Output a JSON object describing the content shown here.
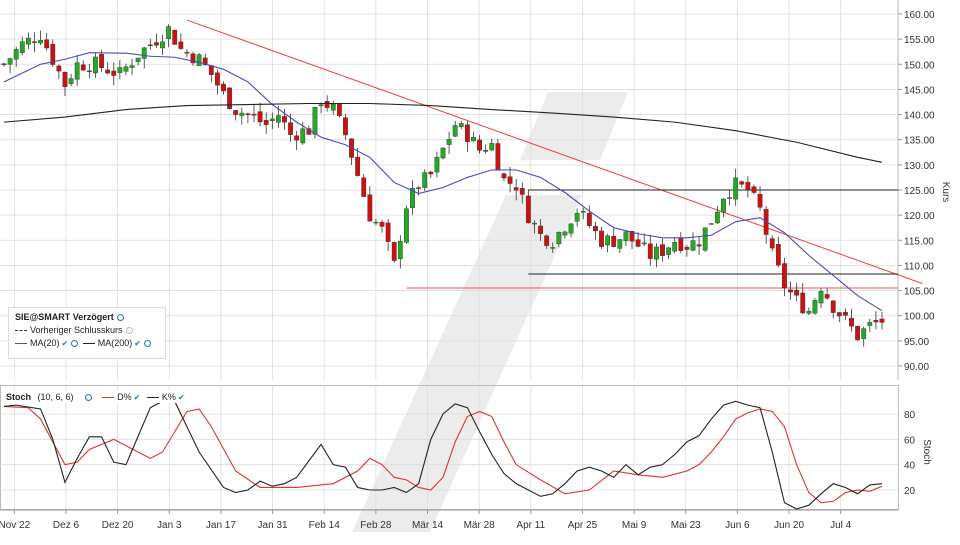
{
  "chart_data": [
    {
      "type": "candlestick",
      "title": "SIE@SMART Verzögert",
      "ylabel": "Kurs",
      "ylim": [
        86,
        162
      ],
      "y_ticks": [
        "160.00",
        "155.00",
        "150.00",
        "145.00",
        "140.00",
        "135.00",
        "130.00",
        "125.00",
        "120.00",
        "115.00",
        "110.00",
        "105.00",
        "100.00",
        "95.00",
        "90.00"
      ],
      "x_ticks": [
        "Nov 22",
        "Dez 6",
        "Dez 20",
        "Jan 3",
        "Jan 17",
        "Jan 31",
        "Feb 14",
        "Feb 28",
        "Mär 14",
        "Mär 28",
        "Apr 11",
        "Apr 25",
        "Mai 9",
        "Mai 23",
        "Jun 6",
        "Jun 20",
        "Jul 4"
      ],
      "grid": true,
      "legend": [
        "Vorheriger Schlusskurs",
        "MA(20)",
        "MA(200)"
      ],
      "close_anchors": [
        [
          0,
          150
        ],
        [
          3,
          154
        ],
        [
          6,
          156
        ],
        [
          8,
          151
        ],
        [
          10,
          146
        ],
        [
          12,
          150
        ],
        [
          15,
          150
        ],
        [
          17,
          149
        ],
        [
          19,
          148
        ],
        [
          22,
          152
        ],
        [
          25,
          155
        ],
        [
          27,
          157
        ],
        [
          29,
          153
        ],
        [
          32,
          151
        ],
        [
          34,
          148
        ],
        [
          36,
          144
        ],
        [
          38,
          141
        ],
        [
          40,
          140
        ],
        [
          43,
          138
        ],
        [
          45,
          140
        ],
        [
          47,
          136
        ],
        [
          50,
          137
        ],
        [
          52,
          143
        ],
        [
          54,
          141
        ],
        [
          56,
          136
        ],
        [
          58,
          128
        ],
        [
          60,
          120
        ],
        [
          62,
          117
        ],
        [
          64,
          110
        ],
        [
          66,
          122
        ],
        [
          68,
          126
        ],
        [
          70,
          128
        ],
        [
          72,
          133
        ],
        [
          74,
          138
        ],
        [
          76,
          136
        ],
        [
          78,
          133
        ],
        [
          80,
          134
        ],
        [
          82,
          127
        ],
        [
          84,
          126
        ],
        [
          86,
          120
        ],
        [
          88,
          116
        ],
        [
          90,
          115
        ],
        [
          92,
          118
        ],
        [
          94,
          121
        ],
        [
          96,
          118
        ],
        [
          98,
          115
        ],
        [
          100,
          115
        ],
        [
          102,
          116
        ],
        [
          104,
          114
        ],
        [
          106,
          112
        ],
        [
          108,
          113
        ],
        [
          110,
          115
        ],
        [
          112,
          114
        ],
        [
          114,
          115
        ],
        [
          116,
          119
        ],
        [
          118,
          124
        ],
        [
          120,
          126
        ],
        [
          122,
          125
        ],
        [
          124,
          121
        ],
        [
          126,
          112
        ],
        [
          128,
          106
        ],
        [
          130,
          103
        ],
        [
          132,
          101
        ],
        [
          134,
          106
        ],
        [
          136,
          102
        ],
        [
          138,
          99
        ],
        [
          140,
          96
        ],
        [
          142,
          98
        ],
        [
          144,
          99
        ]
      ],
      "series": [
        {
          "name": "MA(20)",
          "color": "#4a4abd",
          "values": [
            [
              0,
              146.5
            ],
            [
              6,
              150
            ],
            [
              10,
              151
            ],
            [
              14,
              152.3
            ],
            [
              20,
              152.2
            ],
            [
              24,
              151.6
            ],
            [
              28,
              151.4
            ],
            [
              32,
              150.4
            ],
            [
              36,
              149
            ],
            [
              40,
              146.5
            ],
            [
              44,
              142
            ],
            [
              48,
              138.5
            ],
            [
              52,
              135.5
            ],
            [
              56,
              134
            ],
            [
              60,
              131.5
            ],
            [
              64,
              126.5
            ],
            [
              68,
              124.3
            ],
            [
              72,
              125.5
            ],
            [
              76,
              127.5
            ],
            [
              80,
              129
            ],
            [
              84,
              129
            ],
            [
              88,
              127.5
            ],
            [
              92,
              124.5
            ],
            [
              96,
              120.8
            ],
            [
              100,
              117.5
            ],
            [
              104,
              116.3
            ],
            [
              108,
              115.5
            ],
            [
              112,
              115.5
            ],
            [
              116,
              116
            ],
            [
              120,
              118.7
            ],
            [
              124,
              119.5
            ],
            [
              128,
              116.5
            ],
            [
              132,
              112
            ],
            [
              136,
              108
            ],
            [
              140,
              104
            ],
            [
              144,
              101
            ]
          ]
        },
        {
          "name": "MA(200)",
          "color": "#222222",
          "values": [
            [
              0,
              138.5
            ],
            [
              10,
              139.5
            ],
            [
              20,
              141
            ],
            [
              30,
              141.8
            ],
            [
              40,
              142
            ],
            [
              50,
              142.2
            ],
            [
              60,
              142.2
            ],
            [
              70,
              141.8
            ],
            [
              80,
              141
            ],
            [
              90,
              140.3
            ],
            [
              100,
              139.5
            ],
            [
              110,
              138.5
            ],
            [
              120,
              136.8
            ],
            [
              130,
              134.5
            ],
            [
              140,
              131.5
            ],
            [
              144,
              130.5
            ]
          ]
        }
      ],
      "lines": [
        {
          "kind": "trendline",
          "color": "#ee4444",
          "from": [
            30,
            158.8
          ],
          "to": [
            148,
            106.8
          ]
        },
        {
          "kind": "horizontal",
          "color": "#ee5555",
          "y": 105.5,
          "from_x": 66
        },
        {
          "kind": "horizontal",
          "color": "#222222",
          "y": 125,
          "from_x": 86
        },
        {
          "kind": "horizontal",
          "color": "#222222",
          "y": 108.3,
          "from_x": 86
        }
      ]
    },
    {
      "type": "line",
      "title": "Stoch",
      "params": "(10, 6, 6)",
      "ylabel": "Stoch",
      "ylim": [
        10,
        95
      ],
      "y_ticks": [
        "80",
        "60",
        "40",
        "20"
      ],
      "grid": true,
      "series": [
        {
          "name": "D%",
          "color": "#dd3333",
          "values": [
            [
              0,
              86
            ],
            [
              4,
              85
            ],
            [
              6,
              76
            ],
            [
              10,
              40
            ],
            [
              12,
              42
            ],
            [
              14,
              52
            ],
            [
              18,
              60
            ],
            [
              20,
              55
            ],
            [
              24,
              45
            ],
            [
              26,
              50
            ],
            [
              30,
              82
            ],
            [
              32,
              84
            ],
            [
              34,
              70
            ],
            [
              38,
              35
            ],
            [
              42,
              22
            ],
            [
              46,
              22
            ],
            [
              48,
              22
            ],
            [
              52,
              24
            ],
            [
              54,
              25
            ],
            [
              58,
              35
            ],
            [
              60,
              45
            ],
            [
              62,
              40
            ],
            [
              64,
              30
            ],
            [
              66,
              28
            ],
            [
              68,
              22
            ],
            [
              70,
              20
            ],
            [
              72,
              30
            ],
            [
              74,
              58
            ],
            [
              76,
              78
            ],
            [
              78,
              82
            ],
            [
              80,
              78
            ],
            [
              82,
              58
            ],
            [
              84,
              40
            ],
            [
              88,
              28
            ],
            [
              92,
              17
            ],
            [
              96,
              20
            ],
            [
              100,
              35
            ],
            [
              104,
              32
            ],
            [
              108,
              30
            ],
            [
              112,
              35
            ],
            [
              114,
              40
            ],
            [
              116,
              50
            ],
            [
              118,
              62
            ],
            [
              120,
              76
            ],
            [
              122,
              81
            ],
            [
              124,
              84
            ],
            [
              126,
              82
            ],
            [
              128,
              70
            ],
            [
              130,
              40
            ],
            [
              132,
              18
            ],
            [
              134,
              10
            ],
            [
              136,
              11
            ],
            [
              138,
              18
            ],
            [
              140,
              20
            ],
            [
              142,
              19
            ],
            [
              144,
              23
            ]
          ]
        },
        {
          "name": "K%",
          "color": "#222222",
          "values": [
            [
              0,
              86
            ],
            [
              2,
              87
            ],
            [
              6,
              84
            ],
            [
              8,
              60
            ],
            [
              10,
              26
            ],
            [
              12,
              45
            ],
            [
              14,
              62
            ],
            [
              16,
              62
            ],
            [
              18,
              42
            ],
            [
              20,
              40
            ],
            [
              24,
              85
            ],
            [
              26,
              90
            ],
            [
              28,
              90
            ],
            [
              30,
              70
            ],
            [
              32,
              50
            ],
            [
              36,
              22
            ],
            [
              38,
              18
            ],
            [
              40,
              20
            ],
            [
              42,
              27
            ],
            [
              44,
              23
            ],
            [
              46,
              25
            ],
            [
              48,
              30
            ],
            [
              52,
              56
            ],
            [
              54,
              40
            ],
            [
              56,
              38
            ],
            [
              58,
              22
            ],
            [
              60,
              20
            ],
            [
              62,
              20
            ],
            [
              64,
              22
            ],
            [
              66,
              18
            ],
            [
              68,
              25
            ],
            [
              70,
              60
            ],
            [
              72,
              80
            ],
            [
              74,
              88
            ],
            [
              76,
              85
            ],
            [
              78,
              66
            ],
            [
              80,
              48
            ],
            [
              82,
              33
            ],
            [
              84,
              25
            ],
            [
              86,
              20
            ],
            [
              88,
              15
            ],
            [
              90,
              17
            ],
            [
              92,
              25
            ],
            [
              94,
              35
            ],
            [
              96,
              38
            ],
            [
              98,
              35
            ],
            [
              100,
              30
            ],
            [
              102,
              40
            ],
            [
              104,
              32
            ],
            [
              106,
              38
            ],
            [
              108,
              40
            ],
            [
              110,
              48
            ],
            [
              112,
              58
            ],
            [
              114,
              63
            ],
            [
              116,
              76
            ],
            [
              118,
              87
            ],
            [
              120,
              90
            ],
            [
              122,
              87
            ],
            [
              124,
              85
            ],
            [
              126,
              50
            ],
            [
              128,
              10
            ],
            [
              130,
              5
            ],
            [
              132,
              8
            ],
            [
              134,
              17
            ],
            [
              136,
              25
            ],
            [
              138,
              22
            ],
            [
              140,
              17
            ],
            [
              142,
              24
            ],
            [
              144,
              25
            ]
          ]
        }
      ]
    }
  ],
  "main_legend": {
    "title": "SIE@SMART Verzögert",
    "prev_close": "Vorheriger Schlusskurs",
    "ma20": "MA(20)",
    "ma200": "MA(200)"
  },
  "stoch_legend": {
    "title": "Stoch",
    "params": "(10, 6, 6)",
    "d": "D%",
    "k": "K%"
  },
  "colors": {
    "up": "#22aa22",
    "down": "#cc1111",
    "grid": "#dcdcdc",
    "watermark": "#ececec"
  }
}
